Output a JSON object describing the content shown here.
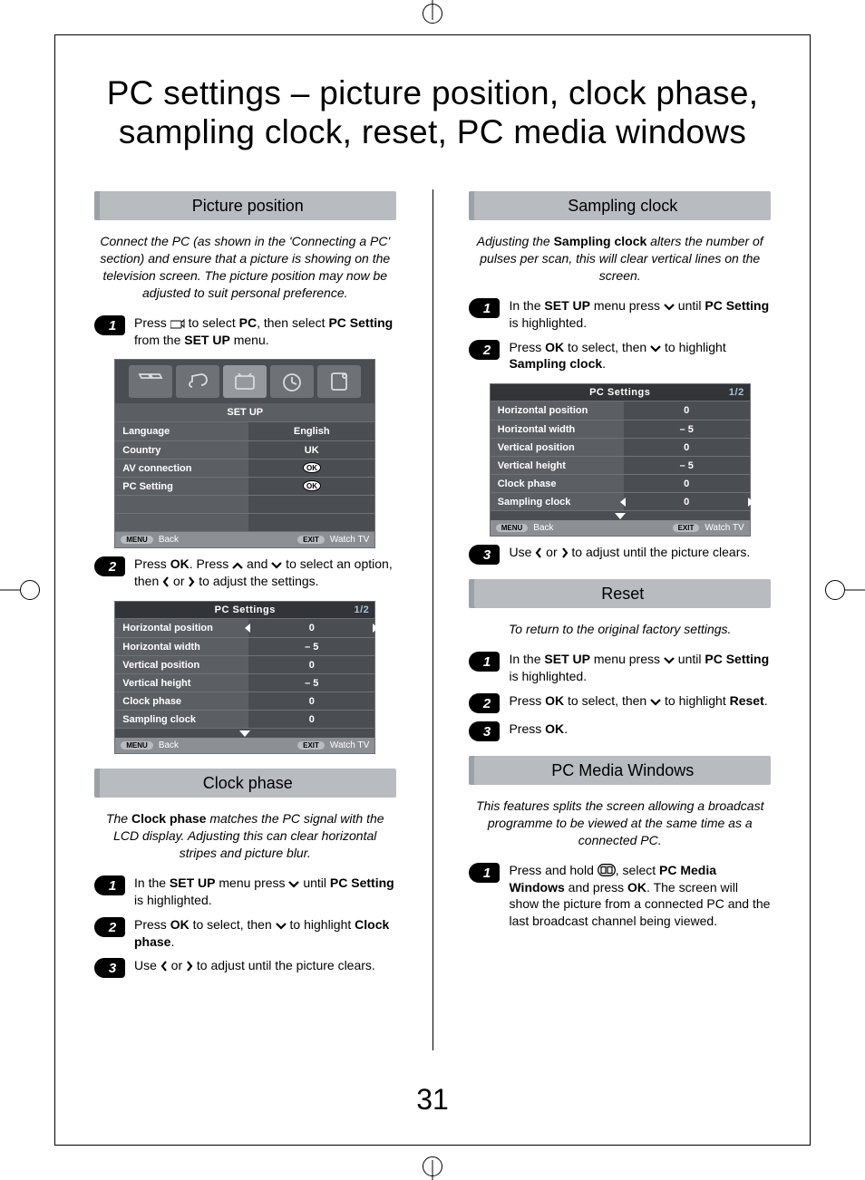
{
  "page_title": "PC settings – picture position, clock phase, sampling clock, reset, PC media windows",
  "page_number": "31",
  "sections": {
    "picture_position": {
      "title": "Picture position",
      "intro": "Connect the PC (as shown in the 'Connecting a PC' section) and ensure that a picture is showing on the television screen. The picture position may now be adjusted to suit personal preference.",
      "step1_a": "Press ",
      "step1_b": " to select ",
      "step1_pc": "PC",
      "step1_c": ", then select ",
      "step1_pcsetting": "PC Setting",
      "step1_d": " from the ",
      "step1_setup": "SET UP",
      "step1_e": " menu.",
      "step2_a": "Press ",
      "step2_ok": "OK",
      "step2_b": ". Press ",
      "step2_c": " and ",
      "step2_d": " to select an option, then ",
      "step2_e": " or ",
      "step2_f": " to adjust the settings."
    },
    "clock_phase": {
      "title": "Clock phase",
      "intro_a": "The ",
      "intro_bold": "Clock phase",
      "intro_b": " matches the PC signal with the LCD display. Adjusting this can clear horizontal stripes and picture blur.",
      "step1_a": "In the ",
      "step1_setup": "SET UP",
      "step1_b": " menu press ",
      "step1_c": " until ",
      "step1_pcsetting": "PC Setting",
      "step1_d": " is highlighted.",
      "step2_a": "Press ",
      "step2_ok": "OK",
      "step2_b": " to select, then ",
      "step2_c": " to highlight ",
      "step2_bold": "Clock phase",
      "step2_d": ".",
      "step3_a": "Use ",
      "step3_b": " or ",
      "step3_c": " to adjust until the picture clears."
    },
    "sampling_clock": {
      "title": "Sampling clock",
      "intro_a": "Adjusting the ",
      "intro_bold": "Sampling clock",
      "intro_b": " alters the number of pulses per scan, this will clear vertical lines on the screen.",
      "step1_a": "In the ",
      "step1_setup": "SET UP",
      "step1_b": " menu press ",
      "step1_c": " until ",
      "step1_pcsetting": "PC Setting",
      "step1_d": " is highlighted.",
      "step2_a": "Press ",
      "step2_ok": "OK",
      "step2_b": " to select, then ",
      "step2_c": " to highlight ",
      "step2_bold": "Sampling clock",
      "step2_d": ".",
      "step3_a": "Use ",
      "step3_b": " or ",
      "step3_c": " to adjust until the picture clears."
    },
    "reset": {
      "title": "Reset",
      "intro": "To return to the original factory settings.",
      "step1_a": "In the ",
      "step1_setup": "SET UP",
      "step1_b": " menu press ",
      "step1_c": " until ",
      "step1_pcsetting": "PC Setting",
      "step1_d": " is highlighted.",
      "step2_a": "Press ",
      "step2_ok": "OK",
      "step2_b": " to select, then ",
      "step2_c": " to highlight ",
      "step2_bold": "Reset",
      "step2_d": ".",
      "step3_a": "Press ",
      "step3_ok": "OK",
      "step3_b": "."
    },
    "pc_media": {
      "title": "PC Media Windows",
      "intro": "This features splits the screen allowing a broadcast programme to be viewed at the same time as a connected PC.",
      "step1_a": "Press and hold ",
      "step1_b": ", select ",
      "step1_bold": "PC Media Windows",
      "step1_c": " and press ",
      "step1_ok": "OK",
      "step1_d": ". The screen will show the picture from a connected PC and the last broadcast channel being viewed."
    }
  },
  "osd_setup": {
    "title": "SET UP",
    "rows": [
      {
        "l": "Language",
        "r": "English"
      },
      {
        "l": "Country",
        "r": "UK"
      },
      {
        "l": "AV connection",
        "r": "OK"
      },
      {
        "l": "PC Setting",
        "r": "OK"
      }
    ],
    "ftr_menu": "MENU",
    "ftr_back": "Back",
    "ftr_exit": "EXIT",
    "ftr_watch": "Watch TV"
  },
  "osd_pcsettings": {
    "title": "PC Settings",
    "page": "1/2",
    "rows": [
      {
        "l": "Horizontal position",
        "r": "0",
        "sel": true
      },
      {
        "l": "Horizontal width",
        "r": "– 5"
      },
      {
        "l": "Vertical position",
        "r": "0"
      },
      {
        "l": "Vertical height",
        "r": "– 5"
      },
      {
        "l": "Clock phase",
        "r": "0"
      },
      {
        "l": "Sampling clock",
        "r": "0"
      }
    ]
  },
  "osd_pcsettings2": {
    "title": "PC Settings",
    "page": "1/2",
    "rows": [
      {
        "l": "Horizontal position",
        "r": "0"
      },
      {
        "l": "Horizontal width",
        "r": "– 5"
      },
      {
        "l": "Vertical position",
        "r": "0"
      },
      {
        "l": "Vertical height",
        "r": "– 5"
      },
      {
        "l": "Clock phase",
        "r": "0"
      },
      {
        "l": "Sampling clock",
        "r": "0",
        "sel": true
      }
    ]
  }
}
